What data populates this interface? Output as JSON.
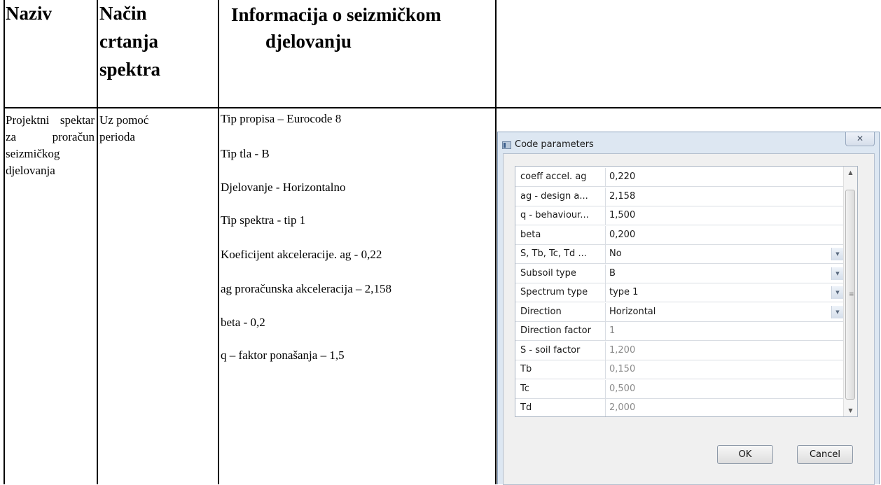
{
  "table": {
    "headers": {
      "naziv": "Naziv",
      "nacin": [
        "Način",
        "crtanja",
        "spektra"
      ],
      "info": [
        "Informacija o seizmičkom",
        "djelovanju"
      ]
    },
    "row": {
      "naziv": "Projektni spektar za proračun seizmičkog djelovanja",
      "nacin": "Uz pomoć perioda",
      "info": [
        "Tip propisa – Eurocode 8",
        "Tip tla - B",
        "Djelovanje - Horizontalno",
        "Tip spektra - tip 1",
        "Koeficijent  akceleracije. ag - 0,22",
        "ag proračunska akceleracija – 2,158",
        "beta - 0,2",
        "q – faktor ponašanja – 1,5"
      ]
    }
  },
  "dialog": {
    "title": "Code parameters",
    "close_glyph": "✕",
    "rows": [
      {
        "key": "coeff accel. ag",
        "value": "0,220",
        "readonly": false,
        "dropdown": false
      },
      {
        "key": "ag - design a...",
        "value": "2,158",
        "readonly": false,
        "dropdown": false
      },
      {
        "key": "q - behaviour...",
        "value": "1,500",
        "readonly": false,
        "dropdown": false
      },
      {
        "key": "beta",
        "value": "0,200",
        "readonly": false,
        "dropdown": false
      },
      {
        "key": "S, Tb, Tc, Td ...",
        "value": "No",
        "readonly": false,
        "dropdown": true
      },
      {
        "key": "Subsoil type",
        "value": "B",
        "readonly": false,
        "dropdown": true
      },
      {
        "key": "Spectrum type",
        "value": "type 1",
        "readonly": false,
        "dropdown": true
      },
      {
        "key": "Direction",
        "value": "Horizontal",
        "readonly": false,
        "dropdown": true
      },
      {
        "key": "Direction factor",
        "value": "1",
        "readonly": true,
        "dropdown": false
      },
      {
        "key": "S - soil factor",
        "value": "1,200",
        "readonly": true,
        "dropdown": false
      },
      {
        "key": "Tb",
        "value": "0,150",
        "readonly": true,
        "dropdown": false
      },
      {
        "key": "Tc",
        "value": "0,500",
        "readonly": true,
        "dropdown": false
      },
      {
        "key": "Td",
        "value": "2,000",
        "readonly": true,
        "dropdown": false
      }
    ],
    "ok_label": "OK",
    "cancel_label": "Cancel"
  }
}
